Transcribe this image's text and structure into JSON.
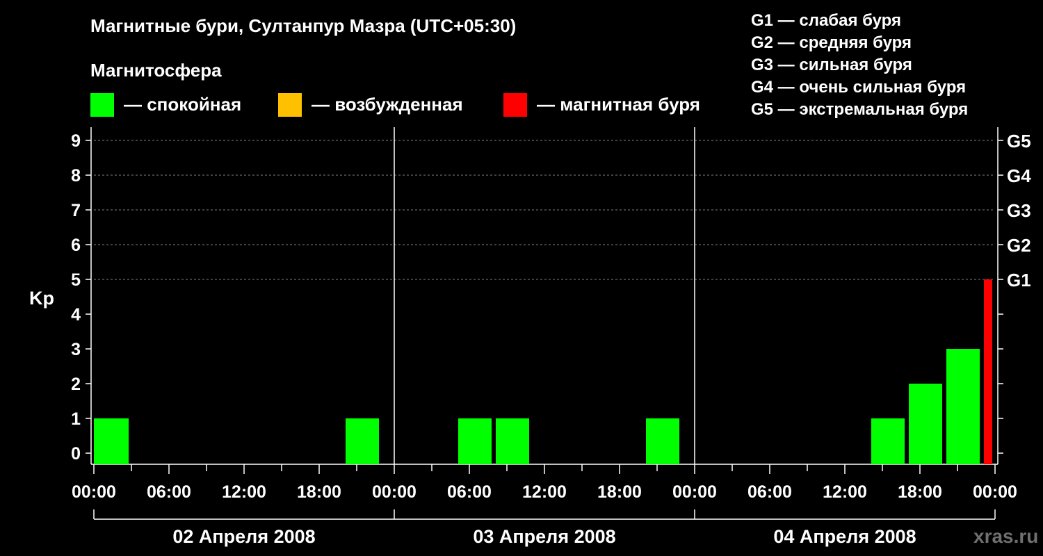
{
  "chart_data": {
    "type": "bar",
    "title": "Магнитные бури, Султанпур Мазра (UTC+05:30)",
    "ylabel": "Kp",
    "ylim": [
      0,
      9
    ],
    "y_ticks": [
      "0",
      "1",
      "2",
      "3",
      "4",
      "5",
      "6",
      "7",
      "8",
      "9"
    ],
    "x_tick_labels": [
      "00:00",
      "06:00",
      "12:00",
      "18:00",
      "00:00",
      "06:00",
      "12:00",
      "18:00",
      "00:00",
      "06:00",
      "12:00",
      "18:00",
      "00:00"
    ],
    "days": [
      "02 Апреля 2008",
      "03 Апреля 2008",
      "04 Апреля 2008"
    ],
    "right_axis": [
      {
        "kp": 5,
        "label": "G1"
      },
      {
        "kp": 6,
        "label": "G2"
      },
      {
        "kp": 7,
        "label": "G3"
      },
      {
        "kp": 8,
        "label": "G4"
      },
      {
        "kp": 9,
        "label": "G5"
      }
    ],
    "grid": "dashed horizontal at Kp 5–9",
    "colors": {
      "calm": "#00ff00",
      "excited": "#ffc000",
      "storm": "#ff0000",
      "background": "#000000",
      "axis": "#ffffff"
    },
    "bars": [
      {
        "day": 0,
        "start_hour": 0,
        "end_hour": 3,
        "kp": 1,
        "level": "calm"
      },
      {
        "day": 0,
        "start_hour": 20,
        "end_hour": 23,
        "kp": 1,
        "level": "calm"
      },
      {
        "day": 1,
        "start_hour": 5,
        "end_hour": 8,
        "kp": 1,
        "level": "calm"
      },
      {
        "day": 1,
        "start_hour": 8,
        "end_hour": 11,
        "kp": 1,
        "level": "calm"
      },
      {
        "day": 1,
        "start_hour": 20,
        "end_hour": 23,
        "kp": 1,
        "level": "calm"
      },
      {
        "day": 2,
        "start_hour": 14,
        "end_hour": 17,
        "kp": 1,
        "level": "calm"
      },
      {
        "day": 2,
        "start_hour": 17,
        "end_hour": 20,
        "kp": 2,
        "level": "calm"
      },
      {
        "day": 2,
        "start_hour": 20,
        "end_hour": 23,
        "kp": 3,
        "level": "calm"
      },
      {
        "day": 2,
        "start_hour": 23,
        "end_hour": 24,
        "kp": 5,
        "level": "storm"
      }
    ]
  },
  "legend": {
    "heading": "Магнитосфера",
    "items": [
      {
        "label": "— спокойная",
        "color": "#00ff00"
      },
      {
        "label": "— возбужденная",
        "color": "#ffc000"
      },
      {
        "label": "— магнитная буря",
        "color": "#ff0000"
      }
    ]
  },
  "g_levels": [
    "G1 — слабая буря",
    "G2 — средняя буря",
    "G3 — сильная буря",
    "G4 — очень сильная буря",
    "G5 — экстремальная буря"
  ],
  "watermark": "xras.ru"
}
